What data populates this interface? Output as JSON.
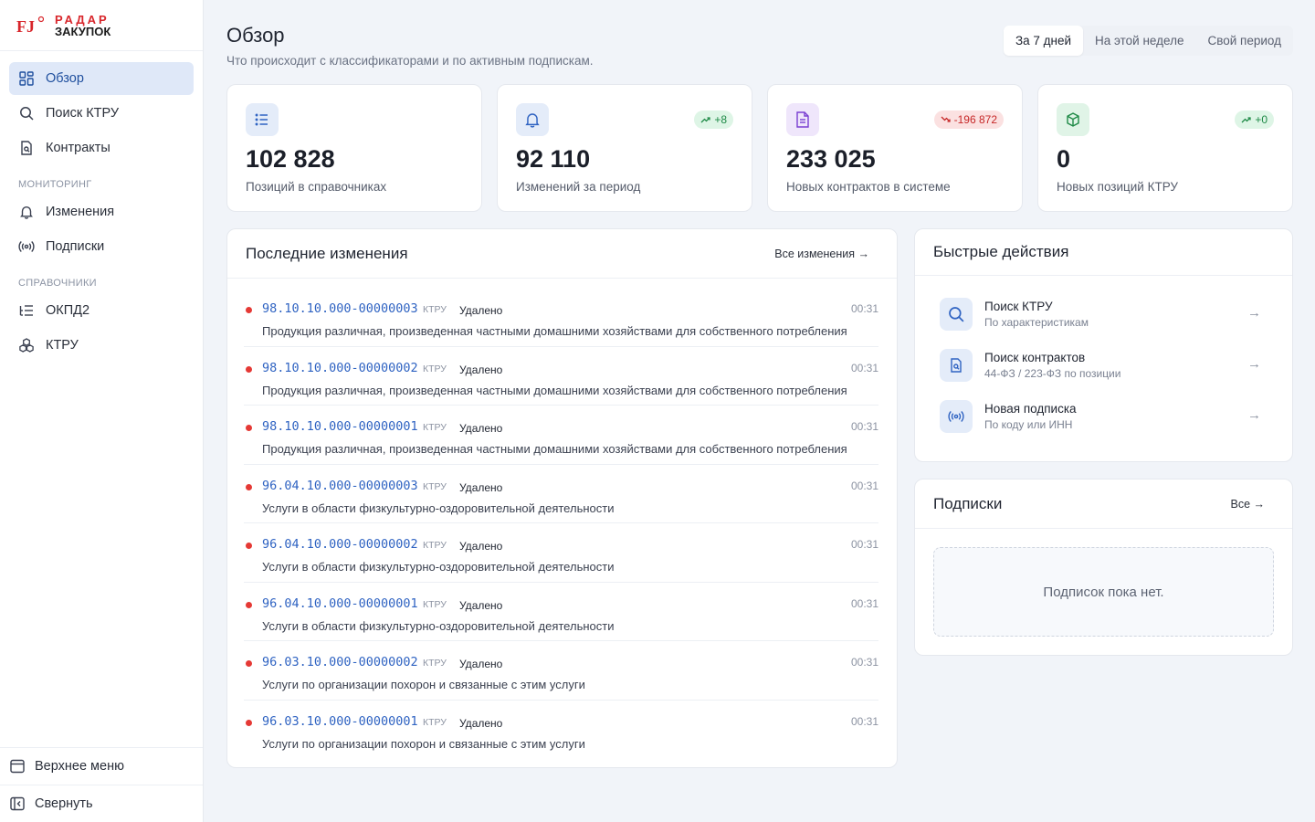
{
  "brand": {
    "line1": "РАДАР",
    "line2": "ЗАКУПОК",
    "mark": "FJ"
  },
  "sidebar": {
    "items": [
      {
        "label": "Обзор",
        "icon": "dashboard-icon",
        "active": true
      },
      {
        "label": "Поиск КТРУ",
        "icon": "search-icon"
      },
      {
        "label": "Контракты",
        "icon": "document-search-icon"
      }
    ],
    "section_monitoring": "Мониторинг",
    "monitoring": [
      {
        "label": "Изменения",
        "icon": "bell-icon"
      },
      {
        "label": "Подписки",
        "icon": "broadcast-icon"
      }
    ],
    "section_reference": "Справочники",
    "reference": [
      {
        "label": "ОКПД2",
        "icon": "list-tree-icon"
      },
      {
        "label": "КТРУ",
        "icon": "boxes-icon"
      }
    ],
    "bottom": [
      {
        "label": "Верхнее меню",
        "icon": "layout-top-icon"
      },
      {
        "label": "Свернуть",
        "icon": "collapse-icon"
      }
    ]
  },
  "header": {
    "title": "Обзор",
    "subtitle": "Что происходит с классификаторами и по активным подпискам.",
    "periods": [
      "За 7 дней",
      "На этой неделе",
      "Свой период"
    ],
    "active_period": "За 7 дней"
  },
  "stats": [
    {
      "value": "102 828",
      "label": "Позиций в справочниках",
      "icon": "list-icon",
      "icon_bg": "#e4ecf9",
      "icon_color": "#2f63c2",
      "badge": ""
    },
    {
      "value": "92 110",
      "label": "Изменений за период",
      "icon": "bell-icon",
      "icon_bg": "#e4ecf9",
      "icon_color": "#2f63c2",
      "badge": "+8",
      "trend": "up"
    },
    {
      "value": "233 025",
      "label": "Новых контрактов в системе",
      "icon": "file-text-icon",
      "icon_bg": "#efe6fb",
      "icon_color": "#7a3fd1",
      "badge": "-196 872",
      "trend": "down"
    },
    {
      "value": "0",
      "label": "Новых позиций КТРУ",
      "icon": "cube-icon",
      "icon_bg": "#e0f4e7",
      "icon_color": "#1f8a47",
      "badge": "+0",
      "trend": "up"
    }
  ],
  "changes": {
    "title": "Последние изменения",
    "link": "Все изменения →",
    "items": [
      {
        "code": "98.10.10.000-00000003",
        "tag": "КТРУ",
        "status": "Удалено",
        "time": "00:31",
        "desc": "Продукция различная, произведенная частными домашними хозяйствами для собственного потребления"
      },
      {
        "code": "98.10.10.000-00000002",
        "tag": "КТРУ",
        "status": "Удалено",
        "time": "00:31",
        "desc": "Продукция различная, произведенная частными домашними хозяйствами для собственного потребления"
      },
      {
        "code": "98.10.10.000-00000001",
        "tag": "КТРУ",
        "status": "Удалено",
        "time": "00:31",
        "desc": "Продукция различная, произведенная частными домашними хозяйствами для собственного потребления"
      },
      {
        "code": "96.04.10.000-00000003",
        "tag": "КТРУ",
        "status": "Удалено",
        "time": "00:31",
        "desc": "Услуги в области физкультурно-оздоровительной деятельности"
      },
      {
        "code": "96.04.10.000-00000002",
        "tag": "КТРУ",
        "status": "Удалено",
        "time": "00:31",
        "desc": "Услуги в области физкультурно-оздоровительной деятельности"
      },
      {
        "code": "96.04.10.000-00000001",
        "tag": "КТРУ",
        "status": "Удалено",
        "time": "00:31",
        "desc": "Услуги в области физкультурно-оздоровительной деятельности"
      },
      {
        "code": "96.03.10.000-00000002",
        "tag": "КТРУ",
        "status": "Удалено",
        "time": "00:31",
        "desc": "Услуги по организации похорон и связанные с этим услуги"
      },
      {
        "code": "96.03.10.000-00000001",
        "tag": "КТРУ",
        "status": "Удалено",
        "time": "00:31",
        "desc": "Услуги по организации похорон и связанные с этим услуги"
      }
    ]
  },
  "quick": {
    "title": "Быстрые действия",
    "items": [
      {
        "title": "Поиск КТРУ",
        "sub": "По характеристикам",
        "icon": "search-icon"
      },
      {
        "title": "Поиск контрактов",
        "sub": "44-ФЗ / 223-ФЗ по позиции",
        "icon": "document-search-icon"
      },
      {
        "title": "Новая подписка",
        "sub": "По коду или ИНН",
        "icon": "broadcast-icon"
      }
    ]
  },
  "subscriptions": {
    "title": "Подписки",
    "link": "Все →",
    "empty": "Подписок пока нет."
  },
  "colors": {
    "accent": "#2f63c2",
    "active_bg": "#dfe8f8",
    "danger": "#e53935",
    "bg": "#f1f4f9"
  }
}
